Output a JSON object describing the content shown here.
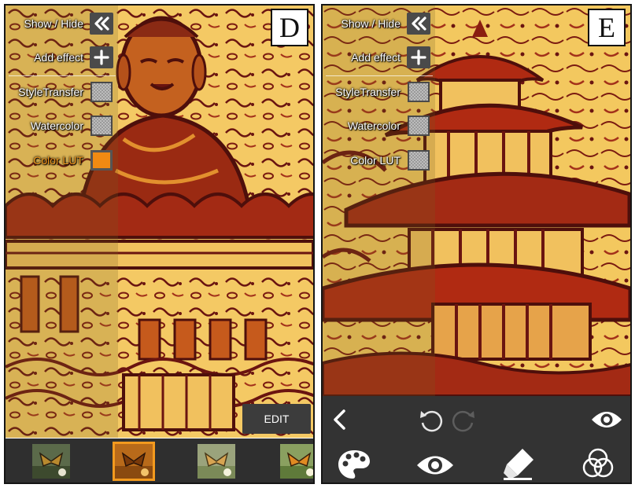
{
  "panels": [
    {
      "label": "D",
      "menu": {
        "show_hide": "Show / Hide",
        "add_effect": "Add effect",
        "effects": [
          {
            "label": "StyleTransfer",
            "active": false
          },
          {
            "label": "Watercolor",
            "active": false
          },
          {
            "label": "Color LUT",
            "active": true
          }
        ]
      },
      "edit_button": "EDIT",
      "thumbnails": [
        {
          "name": "butterfly-original",
          "selected": false
        },
        {
          "name": "butterfly-warm",
          "selected": true
        },
        {
          "name": "butterfly-light",
          "selected": false
        },
        {
          "name": "butterfly-bright",
          "selected": false
        }
      ]
    },
    {
      "label": "E",
      "menu": {
        "show_hide": "Show / Hide",
        "add_effect": "Add effect",
        "effects": [
          {
            "label": "StyleTransfer",
            "active": false
          },
          {
            "label": "Watercolor",
            "active": false
          },
          {
            "label": "Color LUT",
            "active": false
          }
        ]
      },
      "toolbar": {
        "top_icons": [
          "back-icon",
          "undo-icon",
          "redo-icon",
          "eye-icon"
        ],
        "bottom_icons": [
          "palette-icon",
          "eye-icon",
          "eraser-icon",
          "blend-circles-icon"
        ]
      }
    }
  ],
  "colors": {
    "accent": "#f39a1e",
    "menu_button": "#4a4a4a",
    "toolbar_bg": "#333333",
    "thumb_strip_bg": "#2f2f2f",
    "painting_light": "#f4c964",
    "painting_dark": "#6a1410",
    "painting_red": "#b02a12"
  }
}
